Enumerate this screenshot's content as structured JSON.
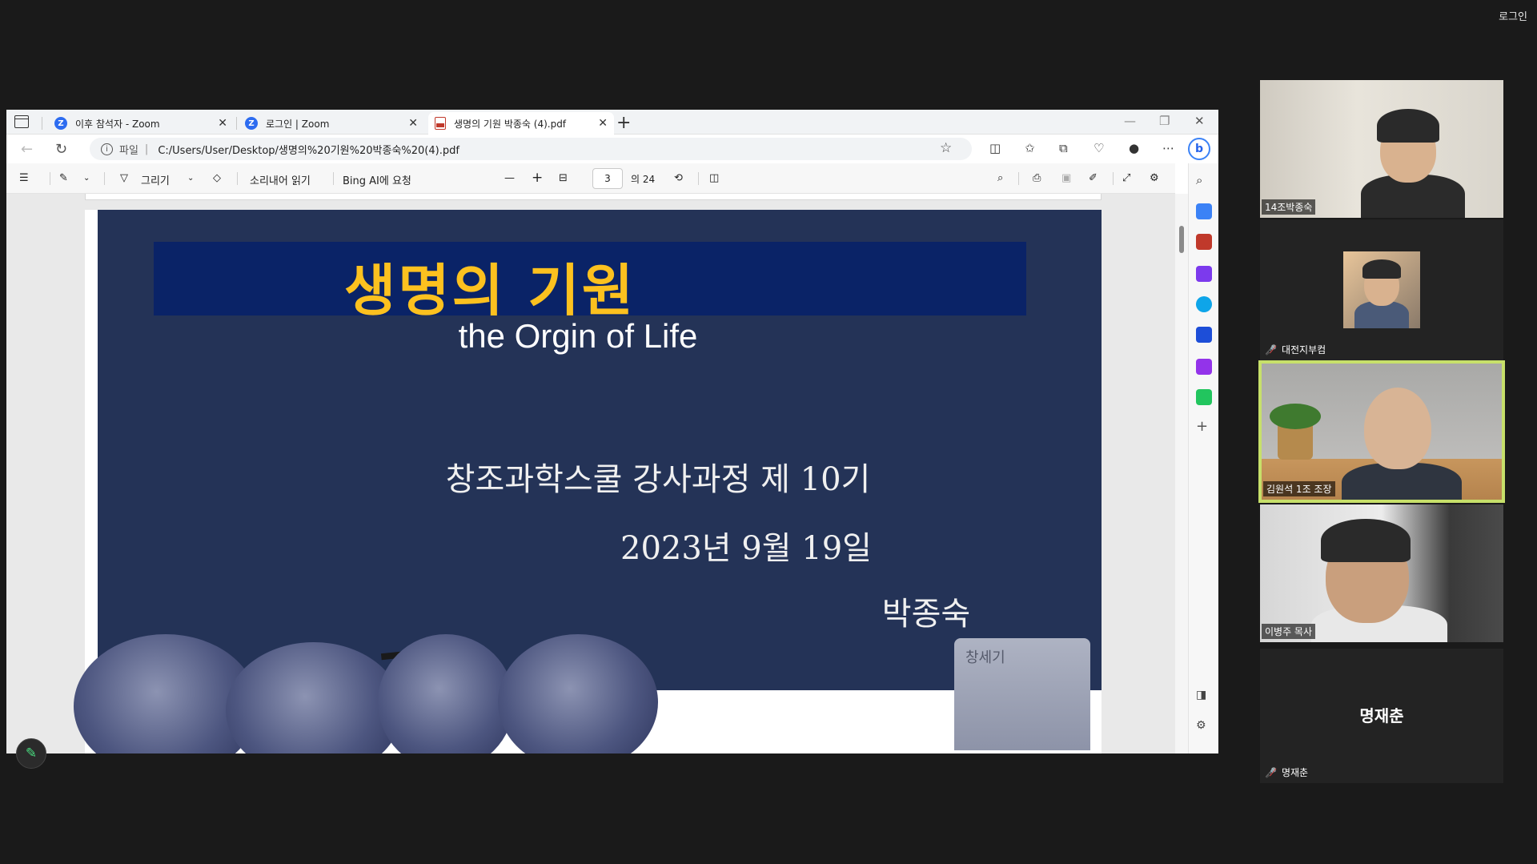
{
  "top_right_label": "로그인",
  "browser": {
    "tabs": [
      {
        "label": "이후 참석자 - Zoom",
        "icon": "zoom-icon",
        "active": false
      },
      {
        "label": "로그인 | Zoom",
        "icon": "zoom-icon",
        "active": false
      },
      {
        "label": "생명의 기원 박종숙 (4).pdf",
        "icon": "pdf-icon",
        "active": true
      }
    ],
    "address": {
      "scheme_label": "파일",
      "url": "C:/Users/User/Desktop/생명의%20기원%20박종숙%20(4).pdf"
    }
  },
  "pdf_toolbar": {
    "draw_label": "그리기",
    "read_aloud_label": "소리내어 읽기",
    "ask_bing_label": "Bing AI에 요청",
    "page_current": "3",
    "page_total_label": "의 24"
  },
  "slide": {
    "title": "생명의 기원",
    "subtitle": "the Orgin of Life",
    "line1": "창조과학스쿨 강사과정 제 10기",
    "line2": "2023년 9월 19일",
    "author": "박종숙",
    "book_text": "창세기"
  },
  "participants": [
    {
      "name": "14조박종숙",
      "muted": false,
      "video": true,
      "speaking": false
    },
    {
      "name": "대전지부컴",
      "muted": true,
      "video": true,
      "speaking": false
    },
    {
      "name": "김원석 1조 조장",
      "muted": false,
      "video": true,
      "speaking": true
    },
    {
      "name": "이병주 목사",
      "muted": false,
      "video": true,
      "speaking": false
    },
    {
      "name": "명재춘",
      "muted": true,
      "video": false,
      "speaking": false,
      "display_name": "명재춘"
    }
  ],
  "colors": {
    "slide_bg": "#243357",
    "title_band": "#0a2367",
    "title_text": "#fcc11f",
    "active_speaker_border": "#c7e06a",
    "zoom_bg": "#1a1a1a"
  }
}
